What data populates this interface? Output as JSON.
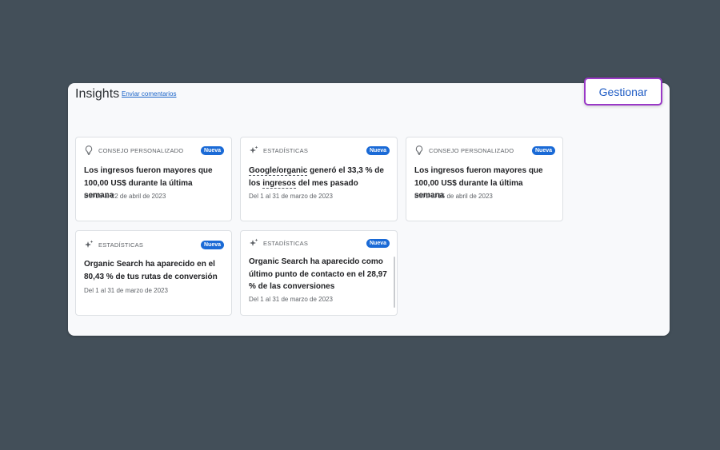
{
  "panel": {
    "title": "Insights",
    "feedback_link": "Enviar comentarios"
  },
  "manage_button": "Gestionar",
  "cards": [
    {
      "icon": "lightbulb-icon",
      "category": "CONSEJO PERSONALIZADO",
      "badge": "Nueva",
      "body": "Los ingresos fueron mayores que 100,00 US$ durante la última semana",
      "date": "Del 16 al 22 de abril de 2023"
    },
    {
      "icon": "sparkle-icon",
      "category": "ESTADÍSTICAS",
      "badge": "Nueva",
      "body_part1": "Google/organic",
      "body_part2": " generó el 33,3 % de los ",
      "body_part3": "ingresos",
      "body_part4": " del mes pasado",
      "date": "Del 1 al 31 de marzo de 2023"
    },
    {
      "icon": "lightbulb-icon",
      "category": "CONSEJO PERSONALIZADO",
      "badge": "Nueva",
      "body": "Los ingresos fueron mayores que 100,00 US$ durante la última semana",
      "date": "Del 9 al 15 de abril de 2023"
    },
    {
      "icon": "sparkle-icon",
      "category": "ESTADÍSTICAS",
      "badge": "Nueva",
      "body": "Organic Search ha aparecido en el 80,43 % de tus rutas de conversión",
      "date": "Del 1 al 31 de marzo de 2023"
    },
    {
      "icon": "sparkle-icon",
      "category": "ESTADÍSTICAS",
      "badge": "Nueva",
      "body": "Organic Search ha aparecido como último punto de contacto en el 28,97 % de las conversiones",
      "date": "Del 1 al 31 de marzo de 2023"
    }
  ],
  "colors": {
    "background": "#434f59",
    "badge": "#1a6ad6",
    "manage_border": "#9a39c7",
    "link": "#1a64c8"
  }
}
